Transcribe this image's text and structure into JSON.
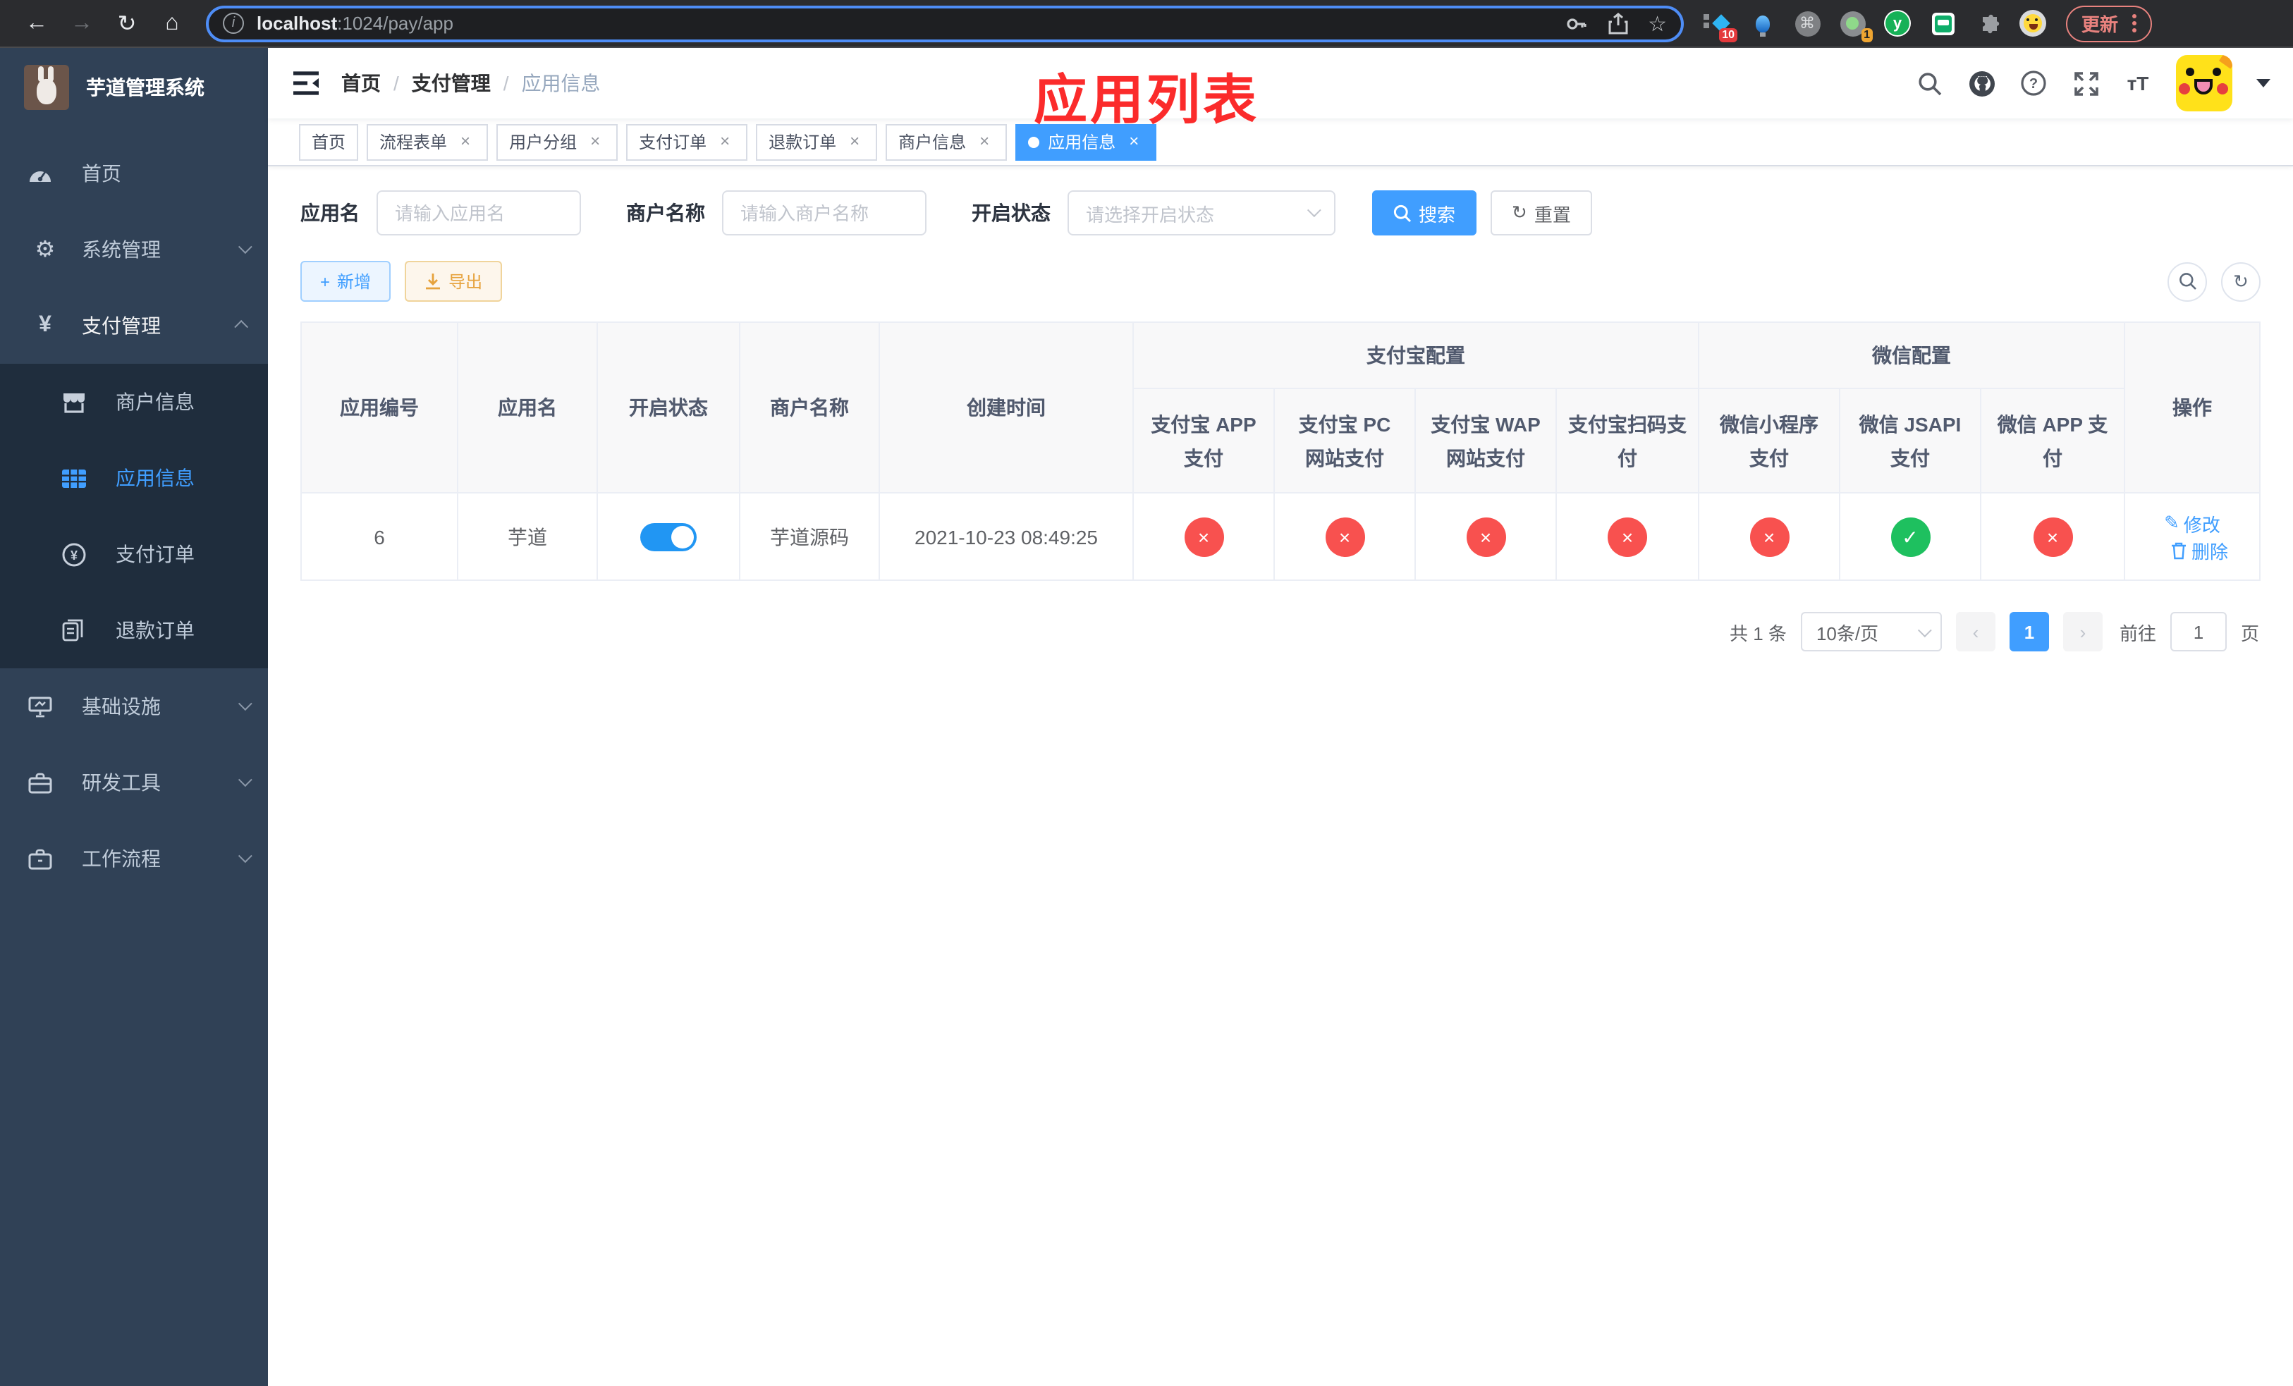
{
  "colors": {
    "accent": "#409eff",
    "danger": "#f8514f",
    "success": "#1ec05f",
    "warning": "#e6a23c",
    "sidebar_bg": "#304156",
    "submenu_bg": "#1f2d3d"
  },
  "icons": {
    "check": "✓",
    "cross": "×",
    "close": "×",
    "yuan": "¥",
    "command": "⌘",
    "star": "☆",
    "home": "⌂",
    "edit_pen": "✎",
    "refresh": "↻",
    "plus": "+",
    "gear": "⚙",
    "back": "←",
    "forward": "→",
    "info": "i",
    "green_y": "y",
    "font_size": "ᴛT"
  },
  "browser": {
    "url_host": "localhost",
    "url_rest": ":1024/pay/app",
    "ext_badge_1": "10",
    "ext_badge_2": "1",
    "update_label": "更新"
  },
  "sidebar": {
    "title": "芋道管理系统",
    "items": [
      {
        "label": "首页"
      },
      {
        "label": "系统管理"
      },
      {
        "label": "支付管理"
      },
      {
        "label": "商户信息"
      },
      {
        "label": "应用信息"
      },
      {
        "label": "支付订单"
      },
      {
        "label": "退款订单"
      },
      {
        "label": "基础设施"
      },
      {
        "label": "研发工具"
      },
      {
        "label": "工作流程"
      }
    ]
  },
  "navbar": {
    "breadcrumb": [
      "首页",
      "支付管理",
      "应用信息"
    ],
    "annotation": "应用列表"
  },
  "tabs": [
    {
      "label": "首页"
    },
    {
      "label": "流程表单"
    },
    {
      "label": "用户分组"
    },
    {
      "label": "支付订单"
    },
    {
      "label": "退款订单"
    },
    {
      "label": "商户信息"
    },
    {
      "label": "应用信息"
    }
  ],
  "filters": {
    "app_name_label": "应用名",
    "app_name_placeholder": "请输入应用名",
    "merchant_label": "商户名称",
    "merchant_placeholder": "请输入商户名称",
    "status_label": "开启状态",
    "status_placeholder": "请选择开启状态",
    "search_label": "搜索",
    "reset_label": "重置"
  },
  "toolbar": {
    "add_label": "新增",
    "export_label": "导出"
  },
  "table": {
    "columns": [
      "应用编号",
      "应用名",
      "开启状态",
      "商户名称",
      "创建时间"
    ],
    "group_alipay": "支付宝配置",
    "group_wechat": "微信配置",
    "sub_columns": [
      "支付宝 APP 支付",
      "支付宝 PC 网站支付",
      "支付宝 WAP 网站支付",
      "支付宝扫码支付",
      "微信小程序支付",
      "微信 JSAPI 支付",
      "微信 APP 支付"
    ],
    "actions_header": "操作",
    "row": {
      "id": "6",
      "name": "芋道",
      "enabled": true,
      "merchant": "芋道源码",
      "created": "2021-10-23 08:49:25",
      "configs": [
        false,
        false,
        false,
        false,
        false,
        true,
        false
      ],
      "edit_label": "修改",
      "delete_label": "删除"
    }
  },
  "pagination": {
    "total_label": "共 1 条",
    "page_size_label": "10条/页",
    "current_page": "1",
    "goto_label": "前往",
    "goto_value": "1",
    "page_unit": "页"
  }
}
